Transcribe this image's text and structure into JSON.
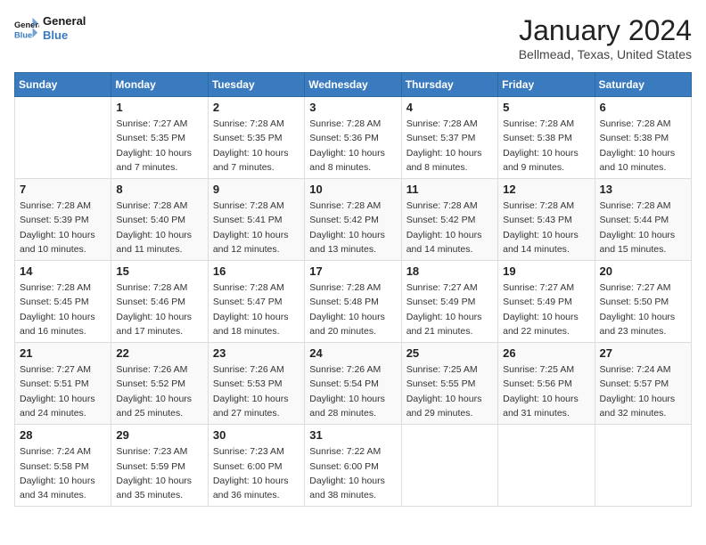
{
  "header": {
    "logo_line1": "General",
    "logo_line2": "Blue",
    "month_title": "January 2024",
    "location": "Bellmead, Texas, United States"
  },
  "weekdays": [
    "Sunday",
    "Monday",
    "Tuesday",
    "Wednesday",
    "Thursday",
    "Friday",
    "Saturday"
  ],
  "weeks": [
    [
      {
        "day": "",
        "info": ""
      },
      {
        "day": "1",
        "info": "Sunrise: 7:27 AM\nSunset: 5:35 PM\nDaylight: 10 hours\nand 7 minutes."
      },
      {
        "day": "2",
        "info": "Sunrise: 7:28 AM\nSunset: 5:35 PM\nDaylight: 10 hours\nand 7 minutes."
      },
      {
        "day": "3",
        "info": "Sunrise: 7:28 AM\nSunset: 5:36 PM\nDaylight: 10 hours\nand 8 minutes."
      },
      {
        "day": "4",
        "info": "Sunrise: 7:28 AM\nSunset: 5:37 PM\nDaylight: 10 hours\nand 8 minutes."
      },
      {
        "day": "5",
        "info": "Sunrise: 7:28 AM\nSunset: 5:38 PM\nDaylight: 10 hours\nand 9 minutes."
      },
      {
        "day": "6",
        "info": "Sunrise: 7:28 AM\nSunset: 5:38 PM\nDaylight: 10 hours\nand 10 minutes."
      }
    ],
    [
      {
        "day": "7",
        "info": "Sunrise: 7:28 AM\nSunset: 5:39 PM\nDaylight: 10 hours\nand 10 minutes."
      },
      {
        "day": "8",
        "info": "Sunrise: 7:28 AM\nSunset: 5:40 PM\nDaylight: 10 hours\nand 11 minutes."
      },
      {
        "day": "9",
        "info": "Sunrise: 7:28 AM\nSunset: 5:41 PM\nDaylight: 10 hours\nand 12 minutes."
      },
      {
        "day": "10",
        "info": "Sunrise: 7:28 AM\nSunset: 5:42 PM\nDaylight: 10 hours\nand 13 minutes."
      },
      {
        "day": "11",
        "info": "Sunrise: 7:28 AM\nSunset: 5:42 PM\nDaylight: 10 hours\nand 14 minutes."
      },
      {
        "day": "12",
        "info": "Sunrise: 7:28 AM\nSunset: 5:43 PM\nDaylight: 10 hours\nand 14 minutes."
      },
      {
        "day": "13",
        "info": "Sunrise: 7:28 AM\nSunset: 5:44 PM\nDaylight: 10 hours\nand 15 minutes."
      }
    ],
    [
      {
        "day": "14",
        "info": "Sunrise: 7:28 AM\nSunset: 5:45 PM\nDaylight: 10 hours\nand 16 minutes."
      },
      {
        "day": "15",
        "info": "Sunrise: 7:28 AM\nSunset: 5:46 PM\nDaylight: 10 hours\nand 17 minutes."
      },
      {
        "day": "16",
        "info": "Sunrise: 7:28 AM\nSunset: 5:47 PM\nDaylight: 10 hours\nand 18 minutes."
      },
      {
        "day": "17",
        "info": "Sunrise: 7:28 AM\nSunset: 5:48 PM\nDaylight: 10 hours\nand 20 minutes."
      },
      {
        "day": "18",
        "info": "Sunrise: 7:27 AM\nSunset: 5:49 PM\nDaylight: 10 hours\nand 21 minutes."
      },
      {
        "day": "19",
        "info": "Sunrise: 7:27 AM\nSunset: 5:49 PM\nDaylight: 10 hours\nand 22 minutes."
      },
      {
        "day": "20",
        "info": "Sunrise: 7:27 AM\nSunset: 5:50 PM\nDaylight: 10 hours\nand 23 minutes."
      }
    ],
    [
      {
        "day": "21",
        "info": "Sunrise: 7:27 AM\nSunset: 5:51 PM\nDaylight: 10 hours\nand 24 minutes."
      },
      {
        "day": "22",
        "info": "Sunrise: 7:26 AM\nSunset: 5:52 PM\nDaylight: 10 hours\nand 25 minutes."
      },
      {
        "day": "23",
        "info": "Sunrise: 7:26 AM\nSunset: 5:53 PM\nDaylight: 10 hours\nand 27 minutes."
      },
      {
        "day": "24",
        "info": "Sunrise: 7:26 AM\nSunset: 5:54 PM\nDaylight: 10 hours\nand 28 minutes."
      },
      {
        "day": "25",
        "info": "Sunrise: 7:25 AM\nSunset: 5:55 PM\nDaylight: 10 hours\nand 29 minutes."
      },
      {
        "day": "26",
        "info": "Sunrise: 7:25 AM\nSunset: 5:56 PM\nDaylight: 10 hours\nand 31 minutes."
      },
      {
        "day": "27",
        "info": "Sunrise: 7:24 AM\nSunset: 5:57 PM\nDaylight: 10 hours\nand 32 minutes."
      }
    ],
    [
      {
        "day": "28",
        "info": "Sunrise: 7:24 AM\nSunset: 5:58 PM\nDaylight: 10 hours\nand 34 minutes."
      },
      {
        "day": "29",
        "info": "Sunrise: 7:23 AM\nSunset: 5:59 PM\nDaylight: 10 hours\nand 35 minutes."
      },
      {
        "day": "30",
        "info": "Sunrise: 7:23 AM\nSunset: 6:00 PM\nDaylight: 10 hours\nand 36 minutes."
      },
      {
        "day": "31",
        "info": "Sunrise: 7:22 AM\nSunset: 6:00 PM\nDaylight: 10 hours\nand 38 minutes."
      },
      {
        "day": "",
        "info": ""
      },
      {
        "day": "",
        "info": ""
      },
      {
        "day": "",
        "info": ""
      }
    ]
  ]
}
